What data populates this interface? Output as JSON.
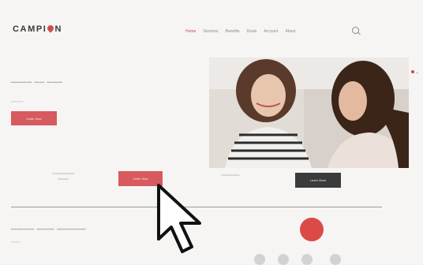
{
  "header": {
    "logo_left": "CAMPI",
    "logo_right": "N",
    "nav": [
      "Home",
      "Services",
      "Benefits",
      "Deals",
      "Account",
      "About"
    ]
  },
  "hero": {
    "button_label": "Order Now"
  },
  "middle": {
    "order_button_label": "Order Now",
    "dark_button_label": "Learn More"
  },
  "colors": {
    "accent": "#d65a5e",
    "dark": "#3b3b3b"
  },
  "icons": [
    "search-icon",
    "heart-icon",
    "mouse-cursor-icon"
  ]
}
